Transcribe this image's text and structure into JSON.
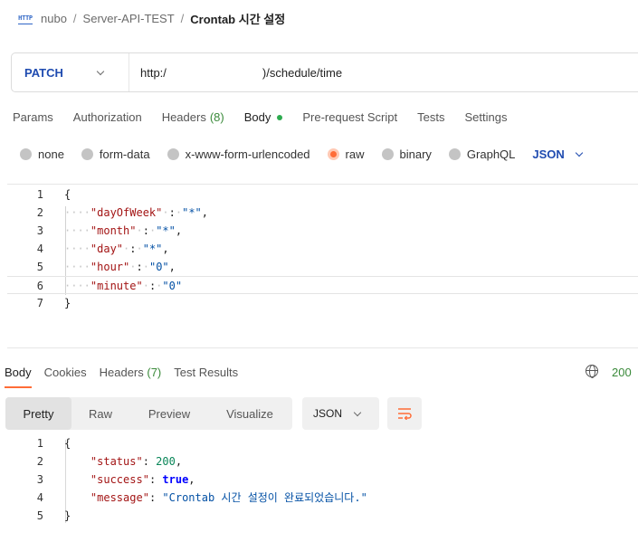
{
  "breadcrumb": {
    "workspace": "nubo",
    "collection": "Server-API-TEST",
    "request": "Crontab 시간 설정",
    "sep": "/"
  },
  "request": {
    "method": "PATCH",
    "url_prefix": "http:/",
    "url_suffix": ")/schedule/time"
  },
  "request_tabs": [
    {
      "label": "Params"
    },
    {
      "label": "Authorization"
    },
    {
      "label": "Headers",
      "count": "(8)"
    },
    {
      "label": "Body",
      "active": true
    },
    {
      "label": "Pre-request Script"
    },
    {
      "label": "Tests"
    },
    {
      "label": "Settings"
    }
  ],
  "body_types": [
    "none",
    "form-data",
    "x-www-form-urlencoded",
    "raw",
    "binary",
    "GraphQL"
  ],
  "body_type_selected": "raw",
  "body_language": "JSON",
  "request_body_lines": [
    {
      "n": "1",
      "text": "{"
    },
    {
      "n": "2",
      "key": "\"dayOfWeek\"",
      "val": "\"*\"",
      "end": ","
    },
    {
      "n": "3",
      "key": "\"month\"",
      "val": "\"*\"",
      "end": ","
    },
    {
      "n": "4",
      "key": "\"day\"",
      "val": "\"*\"",
      "end": ","
    },
    {
      "n": "5",
      "key": "\"hour\"",
      "val": "\"0\"",
      "end": ","
    },
    {
      "n": "6",
      "key": "\"minute\"",
      "val": "\"0\"",
      "end": ""
    },
    {
      "n": "7",
      "text": "}"
    }
  ],
  "response_tabs": [
    {
      "label": "Body",
      "active": true
    },
    {
      "label": "Cookies"
    },
    {
      "label": "Headers",
      "count": "(7)"
    },
    {
      "label": "Test Results"
    }
  ],
  "response_status": "200",
  "response_views": [
    "Pretty",
    "Raw",
    "Preview",
    "Visualize"
  ],
  "response_format": "JSON",
  "response_lines": [
    {
      "n": "1",
      "text": "{"
    },
    {
      "n": "2",
      "key": "\"status\"",
      "val": "200",
      "vtype": "num",
      "end": ","
    },
    {
      "n": "3",
      "key": "\"success\"",
      "val": "true",
      "vtype": "bool",
      "end": ","
    },
    {
      "n": "4",
      "key": "\"message\"",
      "val": "\"Crontab 시간 설정이 완료되었습니다.\"",
      "vtype": "str",
      "end": ""
    },
    {
      "n": "5",
      "text": "}"
    }
  ],
  "colors": {
    "accent": "#ff6c37",
    "method": "#1f4bb0",
    "success": "#3a8a3a",
    "key": "#a31515",
    "string": "#0451a5"
  }
}
